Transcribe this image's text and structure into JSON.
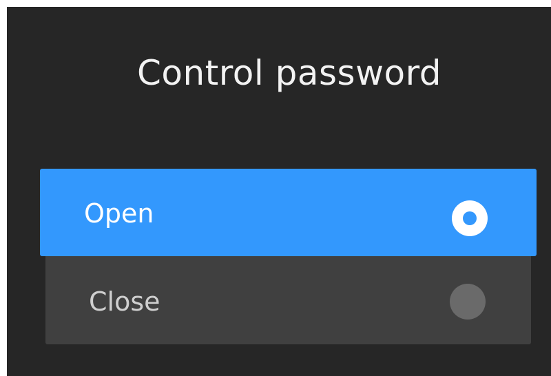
{
  "dialog": {
    "title": "Control password",
    "options": [
      {
        "label": "Open",
        "selected": true
      },
      {
        "label": "Close",
        "selected": false
      }
    ]
  },
  "colors": {
    "background": "#262626",
    "selected_bg": "#3398fd",
    "unselected_bg": "#404040",
    "title_text": "#f2f2f2"
  },
  "icons": {
    "selected": "radio-selected-icon",
    "unselected": "radio-unselected-icon"
  }
}
